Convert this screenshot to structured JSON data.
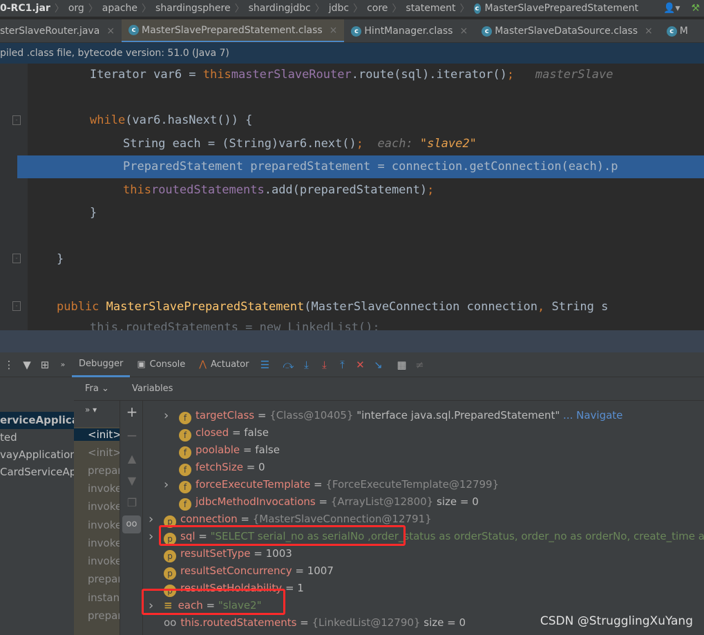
{
  "breadcrumb": [
    "0-RC1.jar",
    "org",
    "apache",
    "shardingsphere",
    "shardingjdbc",
    "jdbc",
    "core",
    "statement",
    "MasterSlavePreparedStatement"
  ],
  "tabs": [
    {
      "label": "sterSlaveRouter.java",
      "active": false
    },
    {
      "label": "MasterSlavePreparedStatement.class",
      "active": true
    },
    {
      "label": "HintManager.class",
      "active": false
    },
    {
      "label": "MasterSlaveDataSource.class",
      "active": false
    },
    {
      "label": "M",
      "active": false
    }
  ],
  "banner": "piled .class file, bytecode version: 51.0 (Java 7)",
  "code": {
    "l1a": "Iterator var6 = ",
    "l1b": "this",
    ".": ".",
    "l1c": "masterSlaveRouter",
    "l1d": ".route(sql).iterator()",
    "l1e": ";",
    "l1hint": "masterSlave",
    "l2a": "while",
    "l2b": "(var6.hasNext()) {",
    "l3a": "String each = (String)var6.next()",
    "l3b": ";",
    "l3hint": "each: ",
    "l3val": "\"slave2\"",
    "l4": "PreparedStatement preparedStatement = connection.getConnection(each).p",
    "l5a": "this",
    "l5b": "routedStatements",
    "l5c": ".add(preparedStatement)",
    "l5d": ";",
    "l6": "}",
    "l7": "}",
    "l8a": "public ",
    "l8b": "MasterSlavePreparedStatement",
    "l8c": "(MasterSlaveConnection connection",
    ",": ", ",
    "l8d": "String s",
    "l9": "this.routedStatements = new LinkedList();"
  },
  "debugger": {
    "tabs": [
      "Debugger",
      "Console",
      "Actuator"
    ],
    "frames_label": "Fra",
    "variables_label": "Variables"
  },
  "threads": [
    "erviceApplicati",
    "ted",
    "vayApplication",
    "CardServiceAp"
  ],
  "frames": [
    "<init>",
    "<init>",
    "prepar",
    "invoke",
    "invoke",
    "invoke",
    "invoke",
    "invoke",
    "prepar",
    "instant",
    "prepar"
  ],
  "variables": [
    {
      "name": "targetClass",
      "eq": " = ",
      "ref": "{Class@10405}",
      "val": " \"interface java.sql.PreparedStatement\"",
      "extra": " ... Navigate",
      "icon": "f",
      "expand": true
    },
    {
      "name": "closed",
      "eq": " = ",
      "val": "false",
      "icon": "f"
    },
    {
      "name": "poolable",
      "eq": " = ",
      "val": "false",
      "icon": "f"
    },
    {
      "name": "fetchSize",
      "eq": " = ",
      "val": "0",
      "icon": "f"
    },
    {
      "name": "forceExecuteTemplate",
      "eq": " = ",
      "ref": "{ForceExecuteTemplate@12799}",
      "icon": "f",
      "expand": true
    },
    {
      "name": "jdbcMethodInvocations",
      "eq": " = ",
      "ref": "{ArrayList@12800}",
      "val": "  size = 0",
      "icon": "f"
    },
    {
      "name": "connection",
      "eq": " = ",
      "ref": "{MasterSlaveConnection@12791}",
      "icon": "p",
      "expand": true
    },
    {
      "name": "sql",
      "eq": " = ",
      "str": "\"SELECT serial_no as serialNo ,order_status as orderStatus, order_no as orderNo, create_time as pay",
      "icon": "p",
      "expand": true
    },
    {
      "name": "resultSetType",
      "eq": " = ",
      "val": "1003",
      "icon": "p"
    },
    {
      "name": "resultSetConcurrency",
      "eq": " = ",
      "val": "1007",
      "icon": "p"
    },
    {
      "name": "resultSetHoldability",
      "eq": " = ",
      "val": "1",
      "icon": "p"
    },
    {
      "name": "each",
      "eq": " = ",
      "str": "\"slave2\"",
      "icon": "stack",
      "expand": true
    },
    {
      "name": "this.routedStatements",
      "eq": " = ",
      "ref": "{LinkedList@12790}",
      "val": "  size = 0",
      "icon": "watch"
    }
  ],
  "watermark": "CSDN @StrugglingXuYang"
}
